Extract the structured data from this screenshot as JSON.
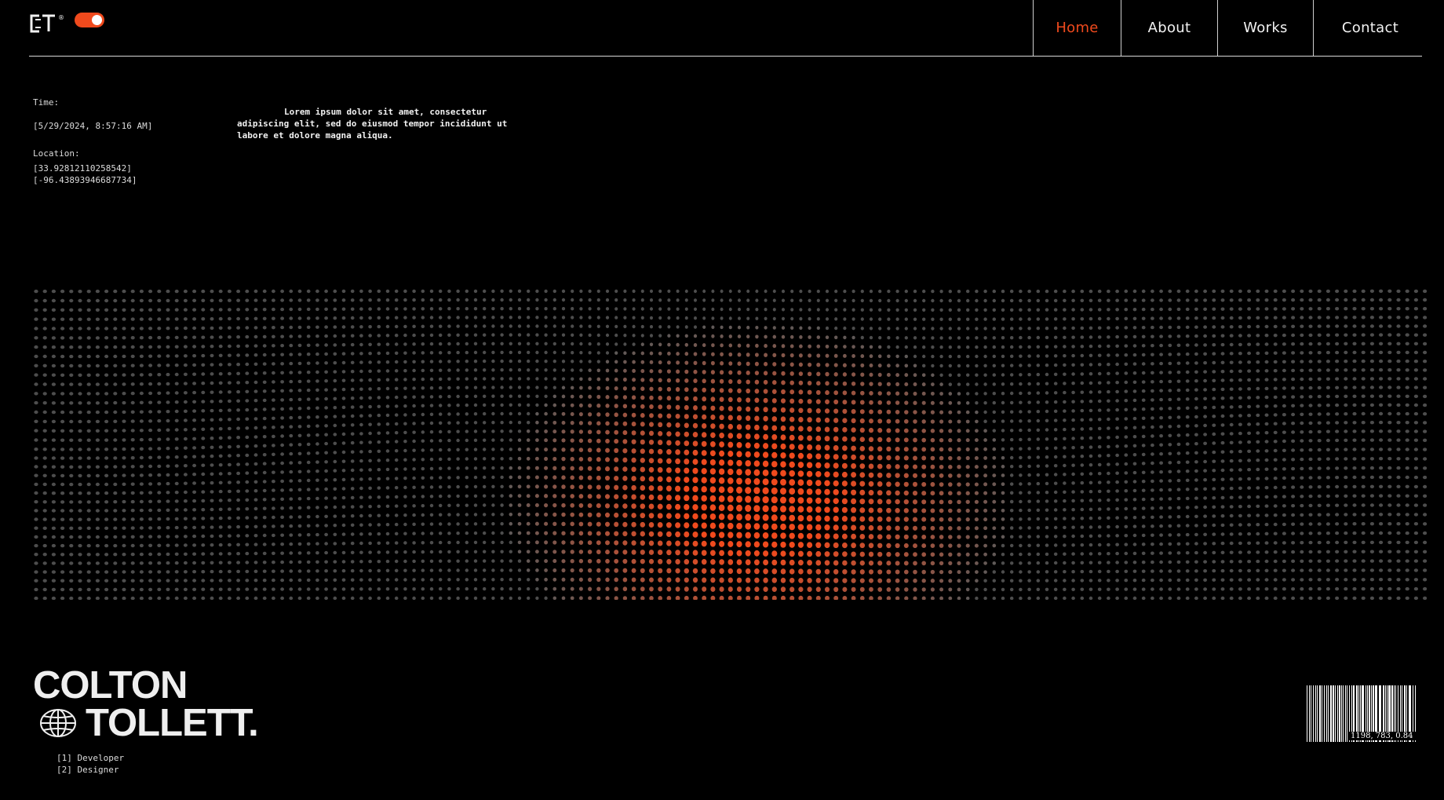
{
  "brand": {
    "logo_text": "CT",
    "logo_mark": "®"
  },
  "colors": {
    "accent": "#f04a1d",
    "background": "#000000",
    "text": "#e6e6e6",
    "dot": "#5a5a5a"
  },
  "nav": {
    "items": [
      {
        "label": "Home",
        "active": true
      },
      {
        "label": "About",
        "active": false
      },
      {
        "label": "Works",
        "active": false
      },
      {
        "label": "Contact",
        "active": false
      }
    ]
  },
  "info": {
    "time_label": "Time:",
    "time_value": "[5/29/2024, 8:57:16 AM]",
    "location_label": "Location:",
    "latitude": "[33.92812110258542]",
    "longitude": "[-96.43893946687734]"
  },
  "blurb": "Lorem ipsum dolor sit amet, consectetur adipiscing elit, sed do eiusmod tempor incididunt ut labore et dolore magna aliqua.",
  "name": {
    "first": "COLTON",
    "last": "TOLLETT."
  },
  "roles": [
    "[1] Developer",
    "[2] Designer"
  ],
  "barcode": {
    "caption": "1198, 783, 0.84"
  },
  "icons": [
    "globe-icon",
    "logo-icon",
    "barcode-icon"
  ]
}
